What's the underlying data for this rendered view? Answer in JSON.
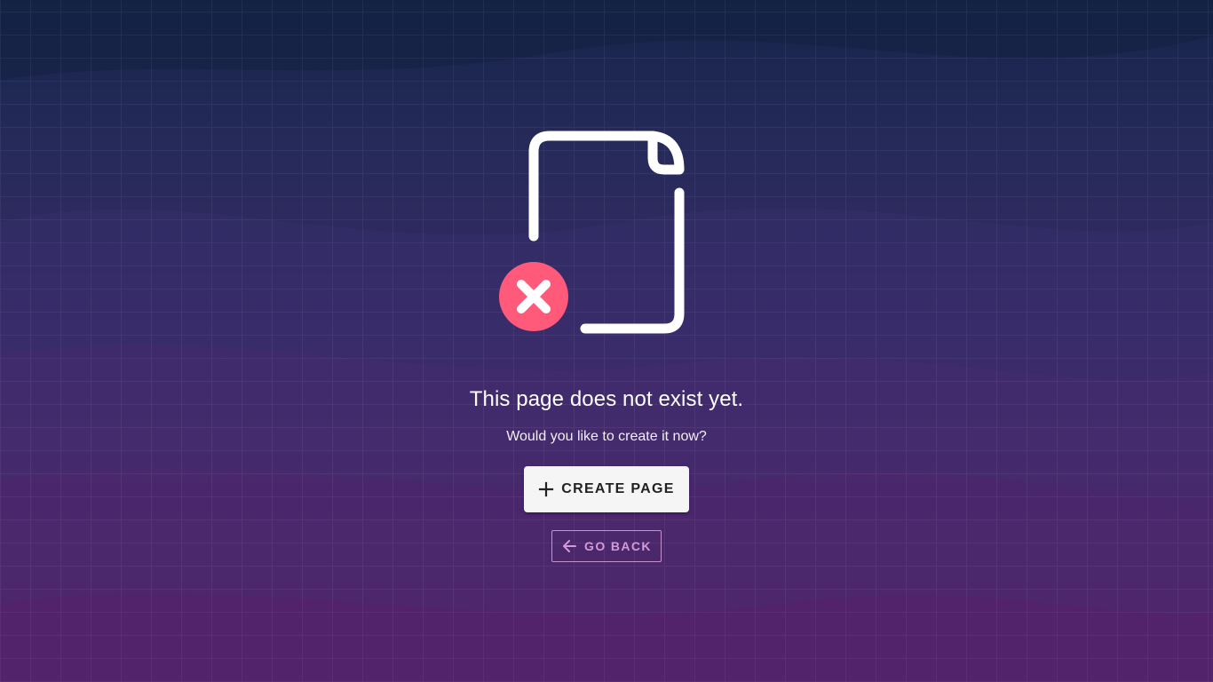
{
  "message": {
    "title": "This page does not exist yet.",
    "subtitle": "Would you like to create it now?"
  },
  "actions": {
    "create_label": "CREATE PAGE",
    "back_label": "GO BACK"
  },
  "icons": {
    "illustration": "missing-document-icon",
    "error_badge": "error-x-icon",
    "create": "plus-icon",
    "back": "arrow-left-icon"
  },
  "colors": {
    "error_badge": "#ff5a7a",
    "back_button_accent": "#d39ad9",
    "create_button_bg": "#f5f5f5"
  }
}
